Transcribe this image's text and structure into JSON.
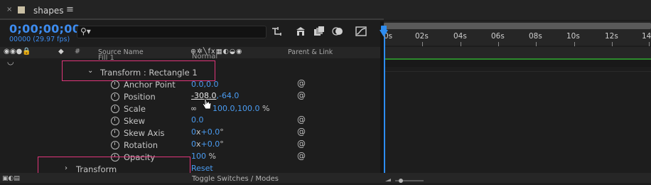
{
  "tab": {
    "close": "×",
    "name": "shapes",
    "menu": "≡"
  },
  "timecode": "0;00;00;00",
  "fps": "00000 (29.97 fps)",
  "search": {
    "placeholder": ""
  },
  "toolbar": {
    "icons": [
      "comp-flowchart-icon",
      "draft-3d-icon",
      "frame-blending-icon",
      "motion-blur-icon",
      "graph-editor-icon"
    ]
  },
  "ruler": {
    "ticks": [
      "0s",
      "02s",
      "04s",
      "06s",
      "08s",
      "10s",
      "12s",
      "14"
    ]
  },
  "columns": {
    "source_name": "Source Name",
    "parent_link": "Parent & Link",
    "hash": "#",
    "switch_icons": "⊕✲╲fx▦◐◒◉"
  },
  "layers": {
    "partial_top": "Fill 1",
    "partial_top_value": "Normal",
    "transform_group": "Transform : Rectangle 1",
    "properties": [
      {
        "name": "Anchor Point",
        "value1": "0.0",
        "value2": "0.0"
      },
      {
        "name": "Position",
        "value1": "-308.0",
        "value2": "-64.0"
      },
      {
        "name": "Scale",
        "value1": "100.0",
        "value2": "100.0",
        "unit": "%"
      },
      {
        "name": "Skew",
        "value1": "0.0"
      },
      {
        "name": "Skew Axis",
        "value1": "0",
        "x": "x",
        "value2": "+0.0",
        "unit": "°"
      },
      {
        "name": "Rotation",
        "value1": "0",
        "x": "x",
        "value2": "+0.0",
        "unit": "°"
      },
      {
        "name": "Opacity",
        "value1": "100",
        "unit": "%"
      }
    ],
    "transform": "Transform",
    "reset": "Reset"
  },
  "bottom": {
    "toggle": "Toggle Switches / Modes"
  },
  "colors": {
    "accent": "#3d8cf0",
    "highlight": "#e0357a",
    "track_green": "#2c8a2c"
  }
}
